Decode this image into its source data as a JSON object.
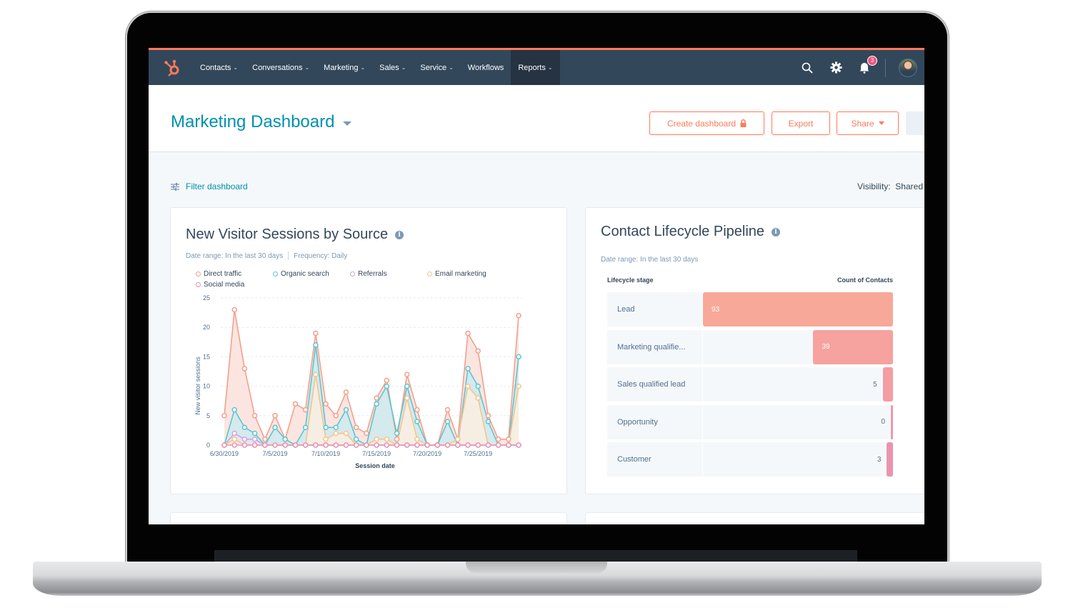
{
  "nav": {
    "logo": "hubspot-sprocket-icon",
    "items": [
      {
        "label": "Contacts",
        "dropdown": true,
        "active": false
      },
      {
        "label": "Conversations",
        "dropdown": true,
        "active": false
      },
      {
        "label": "Marketing",
        "dropdown": true,
        "active": false
      },
      {
        "label": "Sales",
        "dropdown": true,
        "active": false
      },
      {
        "label": "Service",
        "dropdown": true,
        "active": false
      },
      {
        "label": "Workflows",
        "dropdown": false,
        "active": false
      },
      {
        "label": "Reports",
        "dropdown": true,
        "active": true
      }
    ],
    "chevron": "⌄",
    "notification_count": "3",
    "icons": [
      "search-icon",
      "gear-icon",
      "bell-icon",
      "avatar"
    ]
  },
  "header": {
    "title": "Marketing Dashboard",
    "buttons": {
      "create": "Create dashboard",
      "export": "Export",
      "share": "Share"
    }
  },
  "filter": {
    "label": "Filter dashboard",
    "visibility_label": "Visibility:",
    "visibility_value": "Shared"
  },
  "colors": {
    "accent": "#ff7a59",
    "nav_bg": "#33475b",
    "title_teal": "#0091ae",
    "direct": "#f2a08c",
    "organic": "#5dc5cf",
    "referrals": "#c5a8dd",
    "email": "#f5c48e",
    "social": "#ea90b1"
  },
  "sessions_card": {
    "title": "New Visitor Sessions by Source",
    "date_range": "Date range: In the last 30 days",
    "frequency": "Frequency: Daily"
  },
  "pipeline_card": {
    "title": "Contact Lifecycle Pipeline",
    "date_range": "Date range: In the last 30 days",
    "col_stage": "Lifecycle stage",
    "col_count": "Count of Contacts",
    "rows": [
      {
        "stage": "Lead",
        "count": "93",
        "value": 93,
        "color": "#f8a899"
      },
      {
        "stage": "Marketing qualifie...",
        "count": "39",
        "value": 39,
        "color": "#f6a29e"
      },
      {
        "stage": "Sales qualified lead",
        "count": "5",
        "value": 5,
        "color": "#f59da3"
      },
      {
        "stage": "Opportunity",
        "count": "0",
        "value": 0,
        "color": "#f298a9"
      },
      {
        "stage": "Customer",
        "count": "3",
        "value": 3,
        "color": "#ea93af"
      }
    ]
  },
  "chart_data": {
    "type": "area",
    "title": "New Visitor Sessions by Source",
    "xlabel": "Session date",
    "ylabel": "New visitor sessions",
    "ylim": [
      0,
      25
    ],
    "yticks": [
      0,
      5,
      10,
      15,
      20,
      25
    ],
    "xtick_labels": [
      "6/30/2019",
      "7/5/2019",
      "7/10/2019",
      "7/15/2019",
      "7/20/2019",
      "7/25/2019"
    ],
    "xtick_indices": [
      0,
      5,
      10,
      15,
      20,
      25
    ],
    "x": [
      "6/30",
      "7/1",
      "7/2",
      "7/3",
      "7/4",
      "7/5",
      "7/6",
      "7/7",
      "7/8",
      "7/9",
      "7/10",
      "7/11",
      "7/12",
      "7/13",
      "7/14",
      "7/15",
      "7/16",
      "7/17",
      "7/18",
      "7/19",
      "7/20",
      "7/21",
      "7/22",
      "7/23",
      "7/24",
      "7/25",
      "7/26",
      "7/27",
      "7/28",
      "7/29"
    ],
    "grid": true,
    "legend": "top",
    "series": [
      {
        "name": "Direct traffic",
        "color": "#f2a08c",
        "fill": "#fbe0da",
        "values": [
          5,
          23,
          13,
          5,
          1,
          5,
          1,
          7,
          6,
          19,
          7,
          5,
          9,
          3,
          2,
          8,
          11,
          1,
          12,
          6,
          0,
          0,
          6,
          1,
          19,
          16,
          5,
          1,
          1,
          22
        ]
      },
      {
        "name": "Organic search",
        "color": "#5dc5cf",
        "fill": "#cdebee",
        "values": [
          0,
          6,
          3,
          2,
          0,
          3,
          1,
          0,
          3,
          17,
          3,
          3,
          6,
          1,
          0,
          7,
          10,
          2,
          10,
          4,
          0,
          0,
          4,
          0,
          13,
          10,
          4,
          0,
          0,
          15
        ]
      },
      {
        "name": "Referrals",
        "color": "#c5a8dd",
        "fill": "#ece2f4",
        "values": [
          0,
          2,
          1,
          1,
          0,
          0,
          0,
          0,
          0,
          0,
          0,
          0,
          0,
          0,
          0,
          0,
          0,
          0,
          0,
          0,
          0,
          0,
          0,
          0,
          0,
          0,
          0,
          0,
          0,
          0
        ]
      },
      {
        "name": "Email marketing",
        "color": "#f5c48e",
        "fill": "#fcefdf",
        "values": [
          0,
          1,
          0,
          0,
          0,
          0,
          0,
          0,
          0,
          12,
          1,
          2,
          2,
          0,
          0,
          1,
          1,
          0,
          8,
          1,
          0,
          0,
          0,
          1,
          10,
          8,
          0,
          0,
          0,
          10
        ]
      },
      {
        "name": "Social media",
        "color": "#ea90b1",
        "fill": "#fbe3ec",
        "values": [
          0,
          0,
          0,
          0,
          0,
          0,
          0,
          0,
          0,
          0,
          0,
          0,
          0,
          0,
          0,
          0,
          0,
          0,
          0,
          0,
          0,
          0,
          0,
          0,
          0,
          0,
          0,
          0,
          0,
          0
        ]
      }
    ]
  }
}
